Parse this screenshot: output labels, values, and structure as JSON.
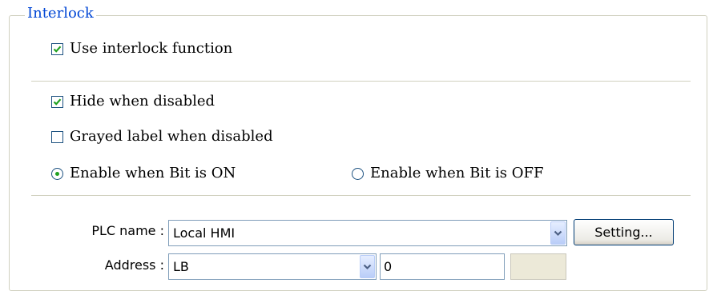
{
  "groupbox": {
    "title": "Interlock"
  },
  "options": {
    "use_interlock": {
      "label": "Use interlock function",
      "checked": true
    },
    "hide_when_disabled": {
      "label": "Hide when disabled",
      "checked": true
    },
    "grayed_label": {
      "label": "Grayed label when disabled",
      "checked": false
    },
    "enable_on": {
      "label": "Enable when Bit is ON",
      "selected": true
    },
    "enable_off": {
      "label": "Enable when Bit is OFF",
      "selected": false
    }
  },
  "plc": {
    "name_label": "PLC name :",
    "name_value": "Local HMI",
    "setting_button": "Setting...",
    "address_label": "Address :",
    "address_device": "LB",
    "address_value": "0"
  },
  "colors": {
    "legend_text": "#0046d5",
    "check_mark": "#21a121",
    "border": "#7f9db9"
  },
  "icons": {
    "check": "check-mark-icon",
    "dropdown": "chevron-down-icon",
    "radio": "radio-dot-icon"
  }
}
